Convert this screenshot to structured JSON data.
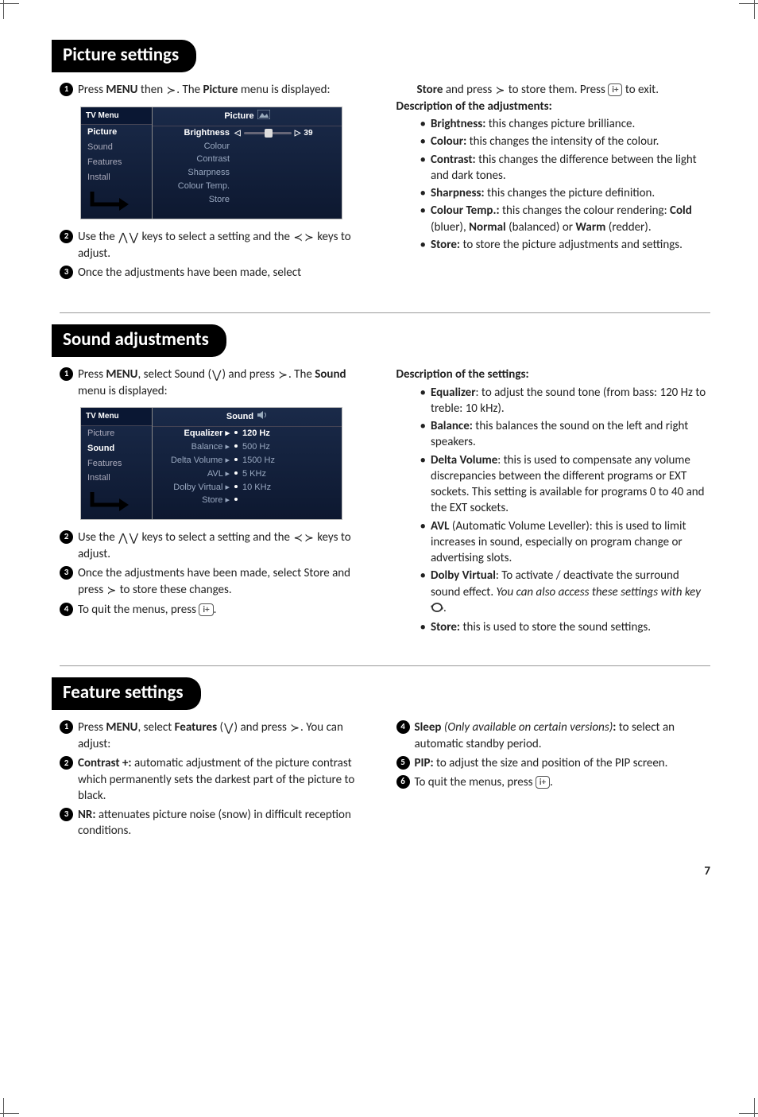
{
  "sections": {
    "picture": {
      "title": "Picture settings",
      "steps": {
        "s1_a": "Press ",
        "s1_menu": "MENU",
        "s1_b": " then ",
        "s1_c": ". The ",
        "s1_picture": "Picture",
        "s1_d": " menu is displayed:",
        "s2_a": "Use the ",
        "s2_b": " keys to select a setting and the ",
        "s2_c": " keys to adjust.",
        "s3": "Once the adjustments have been made, select",
        "right_a": "Store",
        "right_b": " and press ",
        "right_c": " to store them. Press ",
        "right_d": " to exit."
      },
      "desc_head": "Description of the adjustments:",
      "desc": {
        "brightness_t": "Brightness:",
        "brightness_b": " this changes picture brilliance.",
        "colour_t": "Colour:",
        "colour_b": " this changes the intensity of the colour.",
        "contrast_t": "Contrast:",
        "contrast_b": " this changes the difference between the light and dark tones.",
        "sharpness_t": "Sharpness:",
        "sharpness_b": " this changes the picture definition.",
        "ctemp_t": "Colour Temp.:",
        "ctemp_b1": " this changes the colour rendering: ",
        "ctemp_cold": "Cold",
        "ctemp_b2": " (bluer), ",
        "ctemp_normal": "Normal",
        "ctemp_b3": " (balanced) or ",
        "ctemp_warm": "Warm",
        "ctemp_b4": " (redder).",
        "store_t": "Store:",
        "store_b": " to store the picture adjustments and settings."
      },
      "menu": {
        "tvmenu": "TV Menu",
        "picture": "Picture",
        "sound": "Sound",
        "features": "Features",
        "install": "Install",
        "head": "Picture",
        "brightness": "Brightness",
        "brightness_val": "39",
        "colour": "Colour",
        "contrast": "Contrast",
        "sharpness": "Sharpness",
        "ctemp": "Colour Temp.",
        "store": "Store"
      }
    },
    "sound": {
      "title": "Sound adjustments",
      "steps": {
        "s1_a": "Press ",
        "s1_menu": "MENU",
        "s1_b": ", select Sound (",
        "s1_c": ") and press ",
        "s1_d": ". The ",
        "s1_sound": "Sound",
        "s1_e": " menu is displayed:",
        "s2_a": "Use the ",
        "s2_b": " keys to select a setting and the ",
        "s2_c": " keys to adjust.",
        "s3_a": "Once the adjustments have been made, select Store and press ",
        "s3_b": " to store these changes.",
        "s4_a": "To quit the menus, press ",
        "s4_b": "."
      },
      "desc_head": "Description of the settings:",
      "desc": {
        "eq_t": "Equalizer",
        "eq_b": ": to adjust the sound tone (from bass: 120 Hz to treble: 10 kHz).",
        "bal_t": "Balance:",
        "bal_b": " this balances the sound on the left and right speakers.",
        "dv_t": "Delta Volume",
        "dv_b": ": this is used to compensate any volume discrepancies between the different programs or EXT sockets. This setting is available for programs 0 to 40 and the EXT sockets.",
        "avl_t": "AVL",
        "avl_b": " (Automatic Volume Leveller): this is used to limit increases in sound, especially on program change or advertising slots.",
        "dolby_t": "Dolby Virtual",
        "dolby_b": ": To activate / deactivate the surround sound effect. ",
        "dolby_i": "You can also access these settings with key ",
        "dolby_b2": ".",
        "store_t": "Store:",
        "store_b": " this is used to store the sound settings."
      },
      "menu": {
        "tvmenu": "TV Menu",
        "picture": "Picture",
        "sound": "Sound",
        "features": "Features",
        "install": "Install",
        "head": "Sound",
        "equalizer": "Equalizer",
        "v1": "120 Hz",
        "balance": "Balance",
        "v2": "500 Hz",
        "delta": "Delta Volume",
        "v3": "1500 Hz",
        "avl": "AVL",
        "v4": "5 KHz",
        "dolby": "Dolby Virtual",
        "v5": "10 KHz",
        "store": "Store"
      }
    },
    "features": {
      "title": "Feature settings",
      "left": {
        "s1_a": "Press ",
        "s1_menu": "MENU",
        "s1_b": ", select ",
        "s1_feat": "Features",
        "s1_c": " (",
        "s1_d": ") and press ",
        "s1_e": ". You can adjust:",
        "s2_t": "Contrast +:",
        "s2_b": " automatic adjustment of the picture contrast which permanently sets the darkest part of the picture to black.",
        "s3_t": "NR:",
        "s3_b": " attenuates picture noise (snow) in difficult reception conditions."
      },
      "right": {
        "s4_t": "Sleep",
        "s4_i": " (Only available on certain versions)",
        "s4_colon": ":",
        "s4_b": " to select an automatic standby period.",
        "s5_t": "PIP:",
        "s5_b": " to adjust the size and position of the PIP screen.",
        "s6_a": "To quit the menus, press ",
        "s6_b": "."
      }
    }
  },
  "page": "7"
}
